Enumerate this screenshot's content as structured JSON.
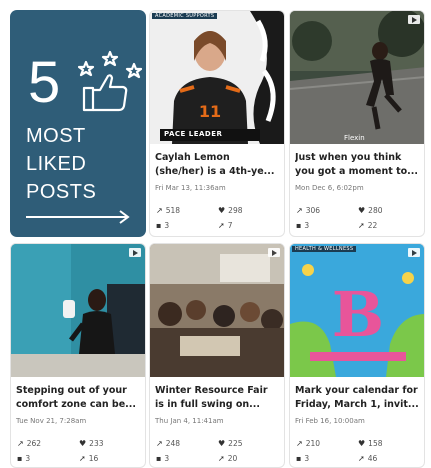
{
  "promo": {
    "number": "5",
    "line1": "MOST",
    "line2": "LIKED",
    "line3": "POSTS",
    "bg_color": "#2f5d78",
    "icon": "thumbs-up-stars-icon",
    "arrow_icon": "arrow-right-icon"
  },
  "posts": [
    {
      "tag": "ACADEMIC SUPPORTS",
      "overlay": "PACE LEADER",
      "caption1": "Caylah Lemon",
      "caption2": "(she/her) is a 4th-ye...",
      "date": "Fri Mar 13, 11:36am",
      "reach": "518",
      "likes": "298",
      "comments": "3",
      "shares": "7"
    },
    {
      "tag": "",
      "overlay": "Flexin",
      "caption1": "Just when you think",
      "caption2": "you got a moment to...",
      "date": "Mon Dec 6, 6:02pm",
      "reach": "306",
      "likes": "280",
      "comments": "3",
      "shares": "22"
    },
    {
      "tag": "",
      "caption1": "Stepping out of your",
      "caption2": "comfort zone can be...",
      "date": "Tue Nov 21, 7:28am",
      "reach": "262",
      "likes": "233",
      "comments": "3",
      "shares": "16"
    },
    {
      "tag": "",
      "caption1": "Winter Resource Fair",
      "caption2": "is in full swing on...",
      "date": "Thu Jan 4, 11:41am",
      "reach": "248",
      "likes": "225",
      "comments": "3",
      "shares": "20"
    },
    {
      "tag": "HEALTH & WELLNESS",
      "caption1": "Mark your calendar for",
      "caption2": "Friday, March 1, invit...",
      "date": "Fri Feb 16, 10:00am",
      "reach": "210",
      "likes": "158",
      "comments": "3",
      "shares": "46"
    }
  ]
}
